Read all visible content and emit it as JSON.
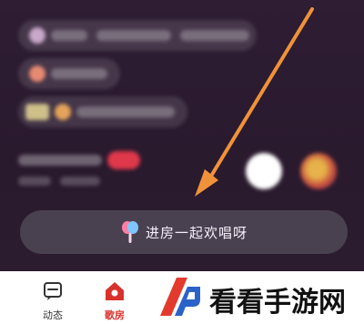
{
  "chat": {
    "enter_room_label": "进房一起欢唱呀"
  },
  "tabs": [
    {
      "label": "动态",
      "icon": "message-icon",
      "active": false
    },
    {
      "label": "歌房",
      "icon": "home-icon",
      "active": true
    }
  ],
  "watermark": {
    "text": "看看手游网"
  },
  "colors": {
    "background": "#2b1c2e",
    "arrow": "#f0923a",
    "tab_active": "#d8322c",
    "tab_inactive": "#333333",
    "badge": "#e0384b"
  }
}
